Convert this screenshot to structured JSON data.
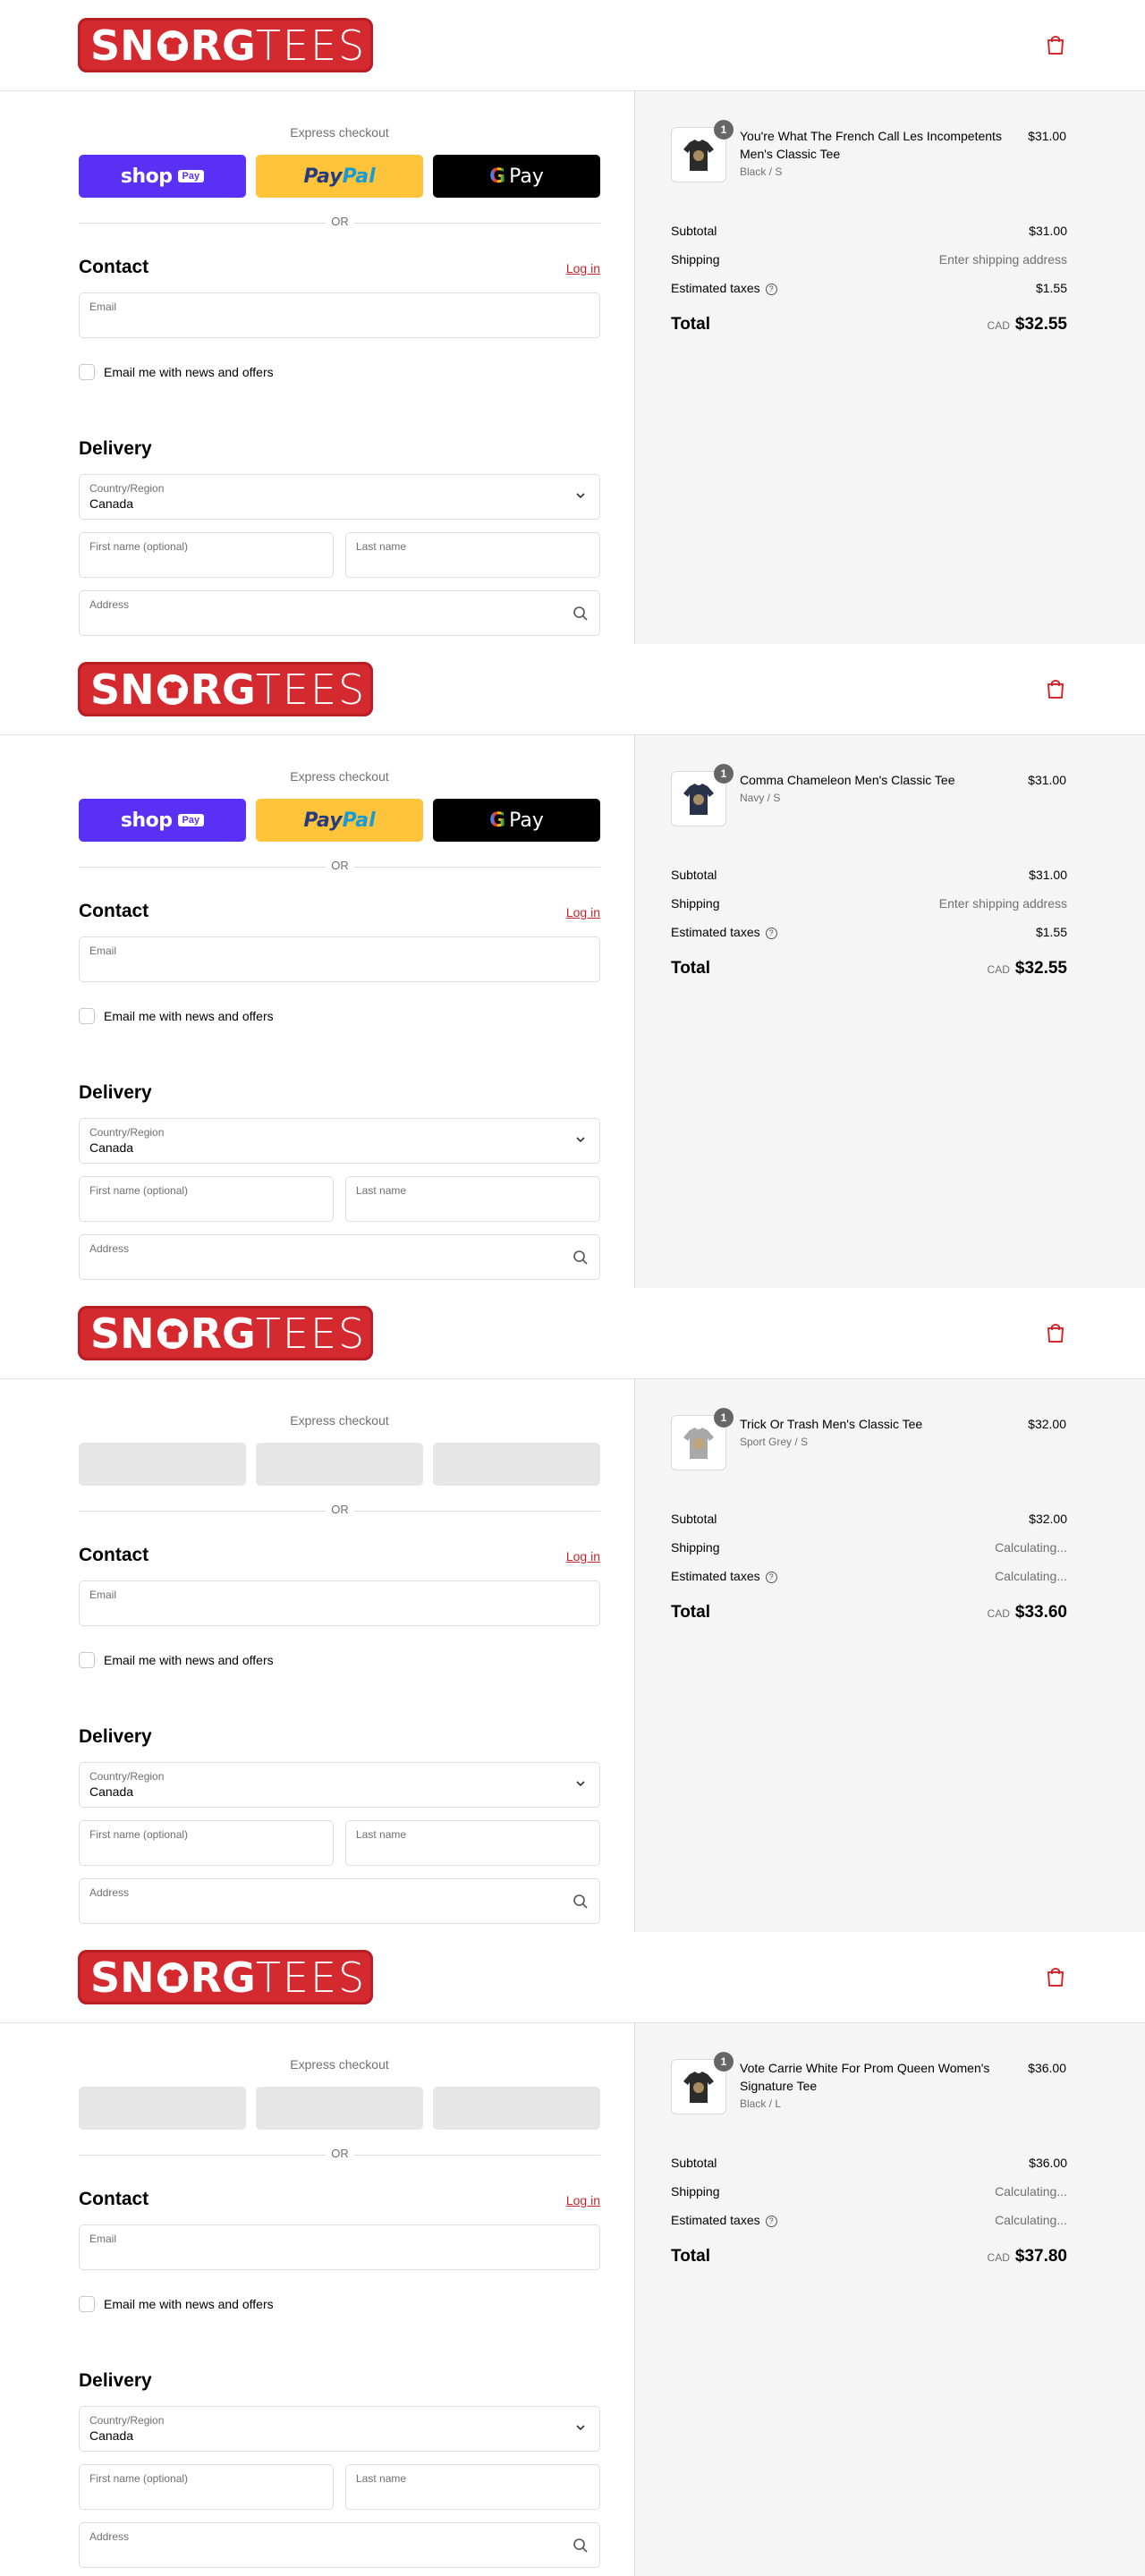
{
  "header": {
    "logo_left": "SN",
    "logo_mid": "RG",
    "logo_right": "TEES"
  },
  "checkout": {
    "express_title": "Express checkout",
    "shop_label": "shop",
    "shop_pay_label": "Pay",
    "paypal_label_1": "Pay",
    "paypal_label_2": "Pal",
    "gpay_g": "G",
    "gpay_label": "Pay",
    "or_label": "OR",
    "contact_title": "Contact",
    "login_label": "Log in",
    "email_label": "Email",
    "newsletter_label": "Email me with news and offers",
    "delivery_title": "Delivery",
    "country_label": "Country/Region",
    "country_value": "Canada",
    "first_name_label": "First name (optional)",
    "last_name_label": "Last name",
    "address_label": "Address"
  },
  "summary_labels": {
    "subtotal": "Subtotal",
    "shipping": "Shipping",
    "estimated_taxes": "Estimated taxes",
    "total": "Total",
    "currency": "CAD"
  },
  "panels": [
    {
      "express_loaded": true,
      "product": {
        "name": "You're What The French Call Les Incompetents Men's Classic Tee",
        "variant": "Black / S",
        "price": "$31.00",
        "quantity": "1",
        "shirt_color": "#2b2b2b"
      },
      "subtotal": "$31.00",
      "shipping": "Enter shipping address",
      "taxes": "$1.55",
      "total": "$32.55"
    },
    {
      "express_loaded": true,
      "product": {
        "name": "Comma Chameleon Men's Classic Tee",
        "variant": "Navy / S",
        "price": "$31.00",
        "quantity": "1",
        "shirt_color": "#28324a"
      },
      "subtotal": "$31.00",
      "shipping": "Enter shipping address",
      "taxes": "$1.55",
      "total": "$32.55"
    },
    {
      "express_loaded": false,
      "product": {
        "name": "Trick Or Trash Men's Classic Tee",
        "variant": "Sport Grey / S",
        "price": "$32.00",
        "quantity": "1",
        "shirt_color": "#a9a9a9"
      },
      "subtotal": "$32.00",
      "shipping": "Calculating...",
      "taxes": "Calculating...",
      "total": "$33.60"
    },
    {
      "express_loaded": false,
      "product": {
        "name": "Vote Carrie White For Prom Queen Women's Signature Tee",
        "variant": "Black / L",
        "price": "$36.00",
        "quantity": "1",
        "shirt_color": "#2b2b2b"
      },
      "subtotal": "$36.00",
      "shipping": "Calculating...",
      "taxes": "Calculating...",
      "total": "$37.80"
    }
  ],
  "colors": {
    "brand_red": "#d42a2f",
    "link_red": "#c4262e",
    "shop_purple": "#5a31f4",
    "paypal_yellow": "#ffc439",
    "summary_bg": "#f5f5f5"
  }
}
